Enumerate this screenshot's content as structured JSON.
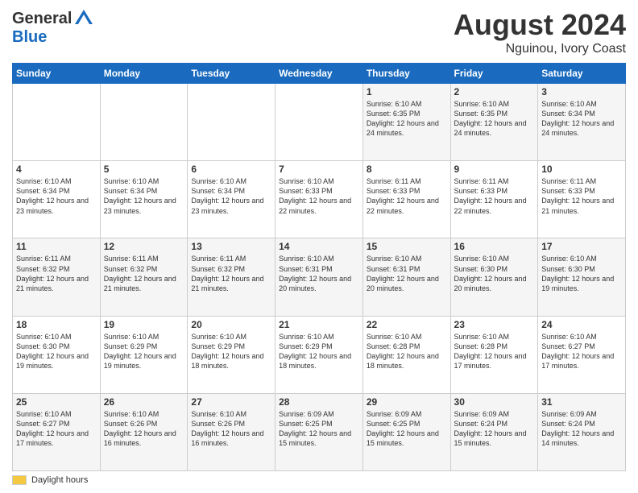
{
  "logo": {
    "line1": "General",
    "line2": "Blue"
  },
  "title": "August 2024",
  "subtitle": "Nguinou, Ivory Coast",
  "days_of_week": [
    "Sunday",
    "Monday",
    "Tuesday",
    "Wednesday",
    "Thursday",
    "Friday",
    "Saturday"
  ],
  "weeks": [
    [
      {
        "day": "",
        "info": ""
      },
      {
        "day": "",
        "info": ""
      },
      {
        "day": "",
        "info": ""
      },
      {
        "day": "",
        "info": ""
      },
      {
        "day": "1",
        "info": "Sunrise: 6:10 AM\nSunset: 6:35 PM\nDaylight: 12 hours\nand 24 minutes."
      },
      {
        "day": "2",
        "info": "Sunrise: 6:10 AM\nSunset: 6:35 PM\nDaylight: 12 hours\nand 24 minutes."
      },
      {
        "day": "3",
        "info": "Sunrise: 6:10 AM\nSunset: 6:34 PM\nDaylight: 12 hours\nand 24 minutes."
      }
    ],
    [
      {
        "day": "4",
        "info": "Sunrise: 6:10 AM\nSunset: 6:34 PM\nDaylight: 12 hours\nand 23 minutes."
      },
      {
        "day": "5",
        "info": "Sunrise: 6:10 AM\nSunset: 6:34 PM\nDaylight: 12 hours\nand 23 minutes."
      },
      {
        "day": "6",
        "info": "Sunrise: 6:10 AM\nSunset: 6:34 PM\nDaylight: 12 hours\nand 23 minutes."
      },
      {
        "day": "7",
        "info": "Sunrise: 6:10 AM\nSunset: 6:33 PM\nDaylight: 12 hours\nand 22 minutes."
      },
      {
        "day": "8",
        "info": "Sunrise: 6:11 AM\nSunset: 6:33 PM\nDaylight: 12 hours\nand 22 minutes."
      },
      {
        "day": "9",
        "info": "Sunrise: 6:11 AM\nSunset: 6:33 PM\nDaylight: 12 hours\nand 22 minutes."
      },
      {
        "day": "10",
        "info": "Sunrise: 6:11 AM\nSunset: 6:33 PM\nDaylight: 12 hours\nand 21 minutes."
      }
    ],
    [
      {
        "day": "11",
        "info": "Sunrise: 6:11 AM\nSunset: 6:32 PM\nDaylight: 12 hours\nand 21 minutes."
      },
      {
        "day": "12",
        "info": "Sunrise: 6:11 AM\nSunset: 6:32 PM\nDaylight: 12 hours\nand 21 minutes."
      },
      {
        "day": "13",
        "info": "Sunrise: 6:11 AM\nSunset: 6:32 PM\nDaylight: 12 hours\nand 21 minutes."
      },
      {
        "day": "14",
        "info": "Sunrise: 6:10 AM\nSunset: 6:31 PM\nDaylight: 12 hours\nand 20 minutes."
      },
      {
        "day": "15",
        "info": "Sunrise: 6:10 AM\nSunset: 6:31 PM\nDaylight: 12 hours\nand 20 minutes."
      },
      {
        "day": "16",
        "info": "Sunrise: 6:10 AM\nSunset: 6:30 PM\nDaylight: 12 hours\nand 20 minutes."
      },
      {
        "day": "17",
        "info": "Sunrise: 6:10 AM\nSunset: 6:30 PM\nDaylight: 12 hours\nand 19 minutes."
      }
    ],
    [
      {
        "day": "18",
        "info": "Sunrise: 6:10 AM\nSunset: 6:30 PM\nDaylight: 12 hours\nand 19 minutes."
      },
      {
        "day": "19",
        "info": "Sunrise: 6:10 AM\nSunset: 6:29 PM\nDaylight: 12 hours\nand 19 minutes."
      },
      {
        "day": "20",
        "info": "Sunrise: 6:10 AM\nSunset: 6:29 PM\nDaylight: 12 hours\nand 18 minutes."
      },
      {
        "day": "21",
        "info": "Sunrise: 6:10 AM\nSunset: 6:29 PM\nDaylight: 12 hours\nand 18 minutes."
      },
      {
        "day": "22",
        "info": "Sunrise: 6:10 AM\nSunset: 6:28 PM\nDaylight: 12 hours\nand 18 minutes."
      },
      {
        "day": "23",
        "info": "Sunrise: 6:10 AM\nSunset: 6:28 PM\nDaylight: 12 hours\nand 17 minutes."
      },
      {
        "day": "24",
        "info": "Sunrise: 6:10 AM\nSunset: 6:27 PM\nDaylight: 12 hours\nand 17 minutes."
      }
    ],
    [
      {
        "day": "25",
        "info": "Sunrise: 6:10 AM\nSunset: 6:27 PM\nDaylight: 12 hours\nand 17 minutes."
      },
      {
        "day": "26",
        "info": "Sunrise: 6:10 AM\nSunset: 6:26 PM\nDaylight: 12 hours\nand 16 minutes."
      },
      {
        "day": "27",
        "info": "Sunrise: 6:10 AM\nSunset: 6:26 PM\nDaylight: 12 hours\nand 16 minutes."
      },
      {
        "day": "28",
        "info": "Sunrise: 6:09 AM\nSunset: 6:25 PM\nDaylight: 12 hours\nand 15 minutes."
      },
      {
        "day": "29",
        "info": "Sunrise: 6:09 AM\nSunset: 6:25 PM\nDaylight: 12 hours\nand 15 minutes."
      },
      {
        "day": "30",
        "info": "Sunrise: 6:09 AM\nSunset: 6:24 PM\nDaylight: 12 hours\nand 15 minutes."
      },
      {
        "day": "31",
        "info": "Sunrise: 6:09 AM\nSunset: 6:24 PM\nDaylight: 12 hours\nand 14 minutes."
      }
    ]
  ],
  "legend": {
    "daylight_label": "Daylight hours"
  }
}
